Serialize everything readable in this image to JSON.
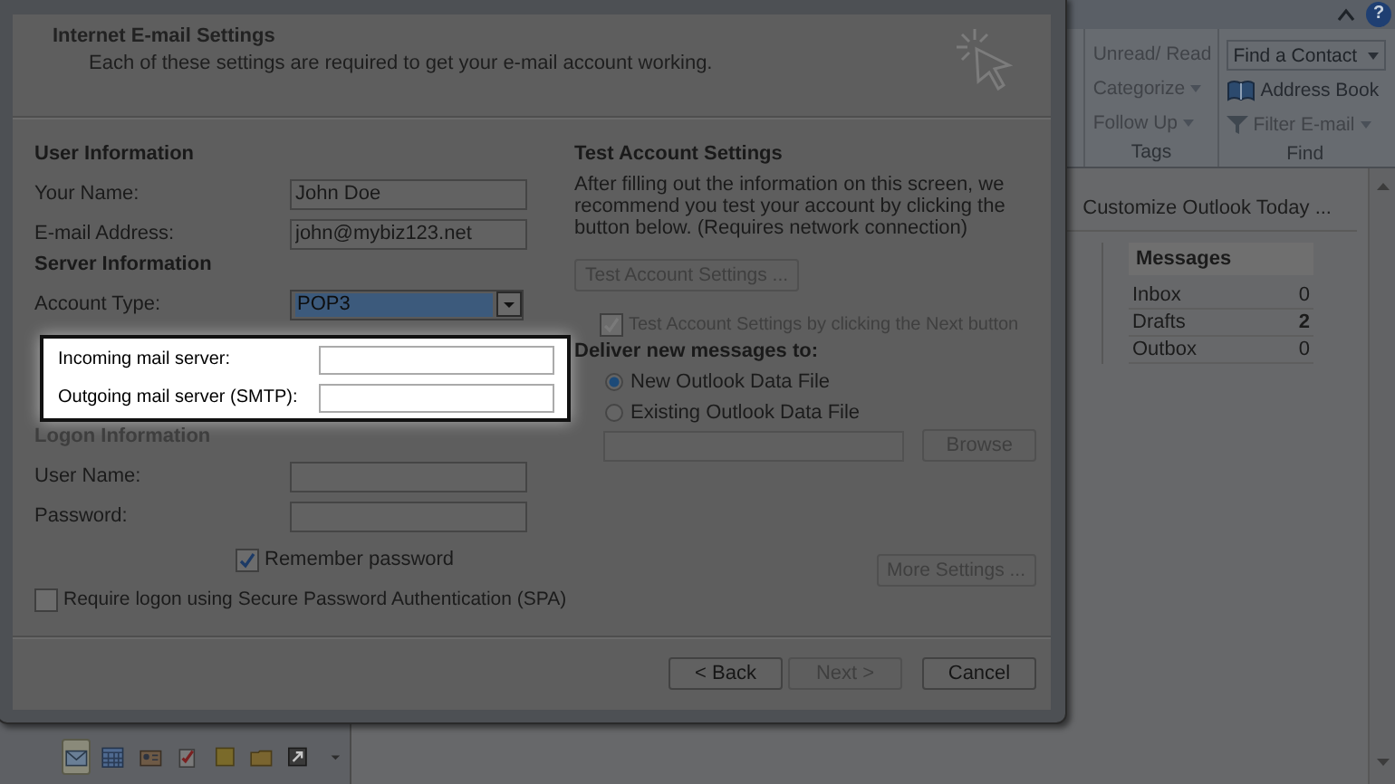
{
  "app": {
    "help_button": "?",
    "ribbon": {
      "groups": [
        {
          "label": "Tags",
          "items": [
            {
              "kind": "plain",
              "label": "Unread/ Read",
              "disabled": true
            },
            {
              "kind": "dropdown",
              "label": "Categorize",
              "disabled": true
            },
            {
              "kind": "dropdown",
              "label": "Follow Up",
              "disabled": true
            }
          ]
        },
        {
          "label": "Find",
          "items": [
            {
              "kind": "field",
              "label": "Find a Contact",
              "disabled": false
            },
            {
              "kind": "book",
              "label": "Address Book",
              "disabled": false
            },
            {
              "kind": "filter",
              "label": "Filter E-mail",
              "disabled": true
            }
          ]
        }
      ]
    },
    "outlook_today": {
      "customize_link": "Customize Outlook Today ...",
      "messages": {
        "heading": "Messages",
        "rows": [
          {
            "label": "Inbox",
            "count": "0",
            "unread": false
          },
          {
            "label": "Drafts",
            "count": "2",
            "unread": true
          },
          {
            "label": "Outbox",
            "count": "0",
            "unread": false
          }
        ]
      }
    },
    "nav_icons": [
      {
        "kind": "mail",
        "selected": true
      },
      {
        "kind": "calendar",
        "selected": false
      },
      {
        "kind": "contacts",
        "selected": false
      },
      {
        "kind": "tasks",
        "selected": false
      },
      {
        "kind": "notes",
        "selected": false
      },
      {
        "kind": "folder",
        "selected": false
      },
      {
        "kind": "shortcut",
        "selected": false
      },
      {
        "kind": "more",
        "selected": false
      }
    ]
  },
  "dialog": {
    "title": "Internet E-mail Settings",
    "subtitle": "Each of these settings are required to get your e-mail account working.",
    "user_information": {
      "heading": "User Information",
      "fields": [
        {
          "label": "Your Name:",
          "value": "John Doe"
        },
        {
          "label": "E-mail Address:",
          "value": "john@mybiz123.net"
        }
      ]
    },
    "server_information": {
      "heading": "Server Information",
      "account_type": {
        "label": "Account Type:",
        "value": "POP3"
      },
      "fields": [
        {
          "label": "Incoming mail server:"
        },
        {
          "label": "Outgoing mail server (SMTP):"
        }
      ]
    },
    "logon_information": {
      "heading": "Logon Information",
      "fields": [
        {
          "label": "User Name:"
        },
        {
          "label": "Password:"
        }
      ],
      "remember_password": {
        "label": "Remember password",
        "checked": true
      },
      "spa": {
        "label": "Require logon using Secure Password Authentication (SPA)",
        "checked": false
      }
    },
    "test_account": {
      "heading": "Test Account Settings",
      "description": "After filling out the information on this screen, we recommend you test your account by clicking the button below. (Requires network connection)",
      "button": {
        "label": "Test Account Settings ...",
        "disabled": true
      },
      "checkbox": {
        "label": "Test Account Settings by clicking the Next button",
        "checked": true,
        "disabled": true
      }
    },
    "deliver": {
      "heading": "Deliver new messages to:",
      "options": [
        {
          "label": "New Outlook Data File",
          "selected": true
        },
        {
          "label": "Existing Outlook Data File",
          "selected": false
        }
      ],
      "browse_button": {
        "label": "Browse",
        "disabled": true
      }
    },
    "more_settings_button": {
      "label": "More Settings ...",
      "disabled": true
    },
    "buttons": [
      {
        "label": "< Back",
        "disabled": false
      },
      {
        "label": "Next >",
        "disabled": true
      },
      {
        "label": "Cancel",
        "disabled": false
      }
    ]
  }
}
